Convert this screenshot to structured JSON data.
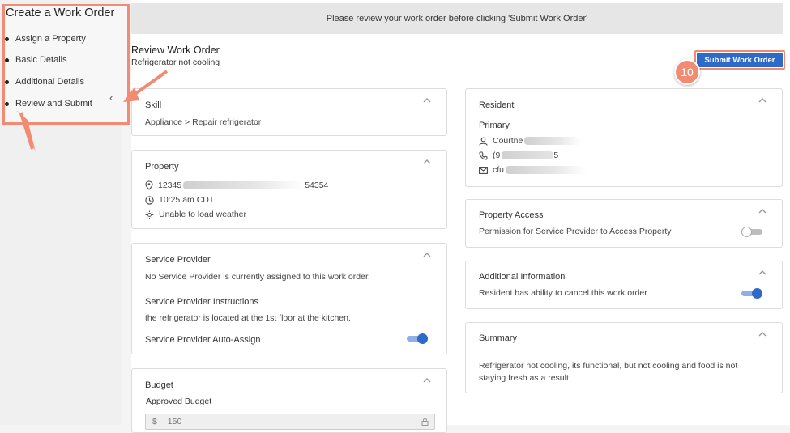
{
  "sidebar": {
    "title": "Create a Work Order",
    "steps": [
      {
        "label": "Assign a Property"
      },
      {
        "label": "Basic Details"
      },
      {
        "label": "Additional Details"
      },
      {
        "label": "Review and Submit"
      }
    ],
    "active_step": "Review and Submit"
  },
  "banner": {
    "text": "Please review your work order before clicking 'Submit Work Order'"
  },
  "review": {
    "title": "Review Work Order",
    "subtitle": "Refrigerator not cooling",
    "submit_label": "Submit Work Order",
    "step_badge": "10"
  },
  "skill": {
    "title": "Skill",
    "value": "Appliance > Repair refrigerator"
  },
  "property": {
    "title": "Property",
    "address_prefix": "12345",
    "address_suffix": "54354",
    "time": "10:25 am CDT",
    "weather": "Unable to load weather"
  },
  "service_provider": {
    "title": "Service Provider",
    "status": "No Service Provider is currently assigned to this work order.",
    "instructions_title": "Service Provider Instructions",
    "instructions": "the refrigerator is located at the 1st floor at the kitchen.",
    "auto_assign_label": "Service Provider Auto-Assign",
    "auto_assign_on": true
  },
  "budget": {
    "title": "Budget",
    "approved_label": "Approved Budget",
    "currency_symbol": "$",
    "value": "150"
  },
  "resident": {
    "title": "Resident",
    "type": "Primary",
    "name_visible": "Courtne",
    "phone_visible_start": "(9",
    "phone_visible_end": "5",
    "email_visible": "cfu"
  },
  "property_access": {
    "title": "Property Access",
    "label": "Permission for Service Provider to Access Property",
    "enabled": false
  },
  "additional_info": {
    "title": "Additional Information",
    "label": "Resident has ability to cancel this work order",
    "enabled": true
  },
  "summary": {
    "title": "Summary",
    "text_line1": "Refrigerator not cooling, its functional, but not cooling and food is not",
    "text_line2": "staying fresh as a result."
  },
  "colors": {
    "accent": "#2e6bc8",
    "annotation": "#f28b74",
    "sidebar_bg": "#f0f0f0"
  }
}
